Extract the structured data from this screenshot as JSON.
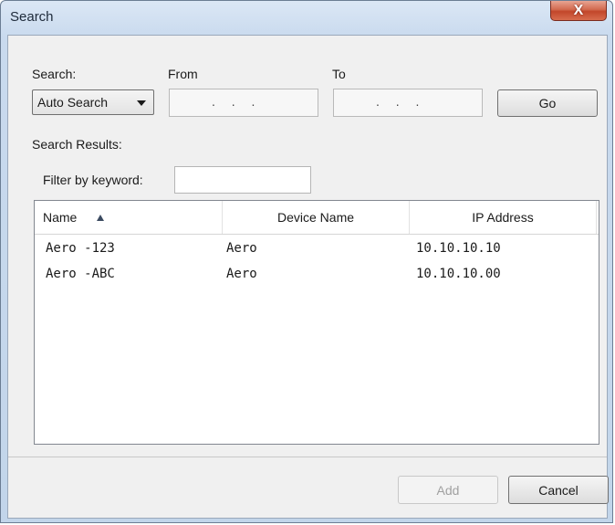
{
  "window": {
    "title": "Search",
    "close_symbol": "X"
  },
  "search": {
    "label": "Search:",
    "mode_value": "Auto Search",
    "from_label": "From",
    "to_label": "To",
    "from_placeholder": ". . .",
    "to_placeholder": ". . .",
    "go_label": "Go"
  },
  "results": {
    "label": "Search Results:",
    "filter_label": "Filter by keyword:",
    "filter_value": "",
    "columns": [
      "Name",
      "Device Name",
      "IP Address"
    ],
    "sort_column": "Name",
    "rows": [
      {
        "name": "Aero -123",
        "device": "Aero",
        "ip": "10.10.10.10"
      },
      {
        "name": "Aero -ABC",
        "device": "Aero",
        "ip": "10.10.10.00"
      }
    ]
  },
  "footer": {
    "add_label": "Add",
    "cancel_label": "Cancel"
  }
}
